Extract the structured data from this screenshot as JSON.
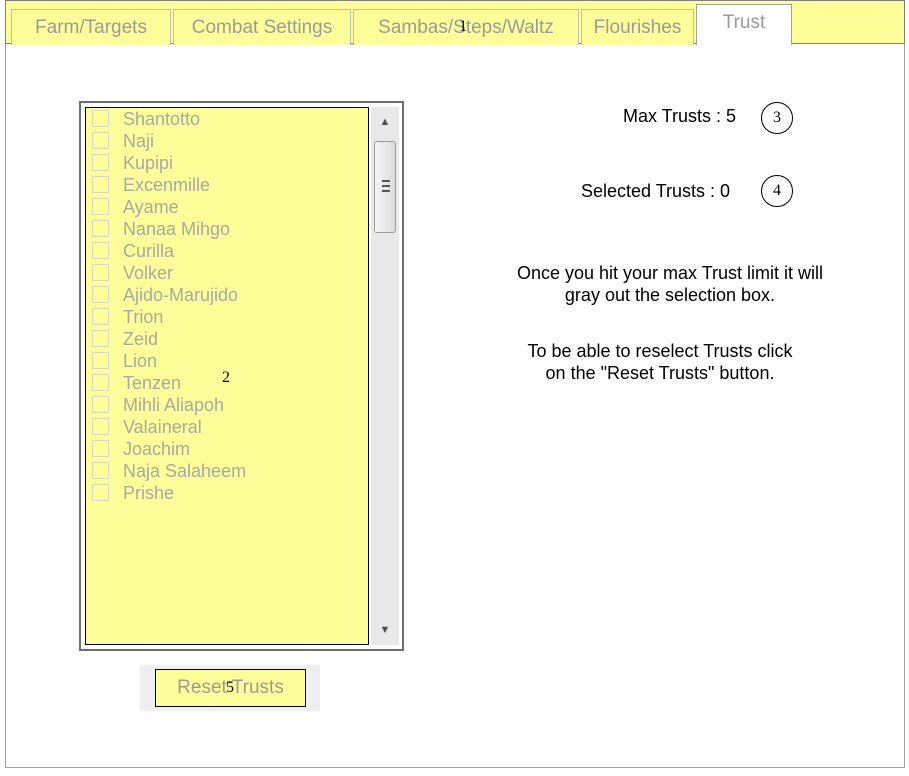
{
  "tabs": [
    {
      "label": "Farm/Targets"
    },
    {
      "label": "Combat Settings"
    },
    {
      "label": "Sambas/Steps/Waltz"
    },
    {
      "label": "Flourishes"
    },
    {
      "label": "Trust",
      "selected": true
    }
  ],
  "markers": {
    "m1": "1",
    "m2": "2",
    "m3": "3",
    "m4": "4",
    "m5": "5"
  },
  "trust_list": {
    "items": [
      {
        "label": "Shantotto",
        "checked": false
      },
      {
        "label": "Naji",
        "checked": false
      },
      {
        "label": "Kupipi",
        "checked": false
      },
      {
        "label": "Excenmille",
        "checked": false
      },
      {
        "label": "Ayame",
        "checked": false
      },
      {
        "label": "Nanaa Mihgo",
        "checked": false
      },
      {
        "label": "Curilla",
        "checked": false
      },
      {
        "label": "Volker",
        "checked": false
      },
      {
        "label": "Ajido-Marujido",
        "checked": false
      },
      {
        "label": "Trion",
        "checked": false
      },
      {
        "label": "Zeid",
        "checked": false
      },
      {
        "label": "Lion",
        "checked": false
      },
      {
        "label": "Tenzen",
        "checked": false
      },
      {
        "label": "Mihli Aliapoh",
        "checked": false
      },
      {
        "label": "Valaineral",
        "checked": false
      },
      {
        "label": "Joachim",
        "checked": false
      },
      {
        "label": "Naja Salaheem",
        "checked": false
      },
      {
        "label": "Prishe",
        "checked": false
      }
    ],
    "scroll_position": 0.05
  },
  "reset_button": {
    "label": "Reset Trusts"
  },
  "max_trusts": {
    "label": "Max Trusts : 5"
  },
  "selected_trusts": {
    "label": "Selected Trusts : 0"
  },
  "info": {
    "line1": "Once you hit your max Trust limit it will",
    "line2": "gray out the selection box.",
    "line3": "To be able to reselect Trusts click",
    "line4": "on the \"Reset Trusts\" button."
  },
  "colors": {
    "accent": "#ffff99",
    "disabled_text": "#9a9a9a"
  },
  "icons": {
    "scroll_up": "scroll-up-arrow-icon",
    "scroll_down": "scroll-down-arrow-icon",
    "thumb_grip": "grip-icon"
  }
}
